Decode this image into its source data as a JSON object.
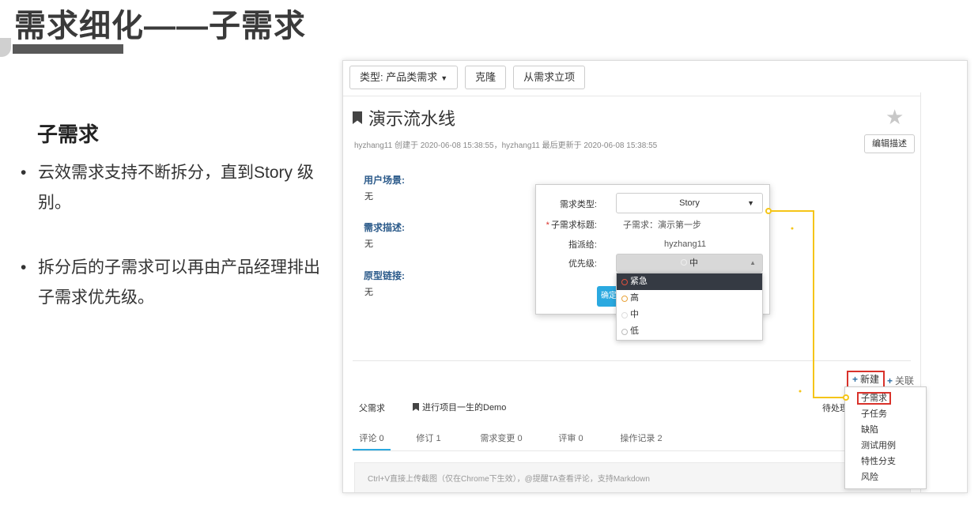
{
  "slide": {
    "title": "需求细化——子需求",
    "heading": "子需求",
    "bullets": [
      "云效需求支持不断拆分，直到Story 级别。",
      "拆分后的子需求可以再由产品经理排出子需求优先级。"
    ],
    "bullet_symbol": "•"
  },
  "toolbar": {
    "type_label": "类型: 产品类需求",
    "clone_label": "克隆",
    "from_req_label": "从需求立项"
  },
  "story": {
    "title": "演示流水线",
    "meta": "hyzhang11 创建于 2020-06-08 15:38:55，hyzhang11 最后更新于 2020-06-08 15:38:55",
    "edit_label": "编辑描述"
  },
  "fields": [
    {
      "label": "用户场景:",
      "value": "无"
    },
    {
      "label": "需求描述:",
      "value": "无"
    },
    {
      "label": "原型链接:",
      "value": "无"
    }
  ],
  "modal": {
    "type_label": "需求类型:",
    "type_value": "Story",
    "title_label": "子需求标题:",
    "title_required": "*",
    "title_value": "子需求：演示第一步",
    "assignee_label": "指派给:",
    "assignee_value": "hyzhang11",
    "priority_label": "优先级:",
    "priority_value": "中",
    "confirm_label": "确定"
  },
  "priority_options": [
    {
      "label": "紧急",
      "color": "#e0503d",
      "active": true
    },
    {
      "label": "高",
      "color": "#e8a33a",
      "active": false
    },
    {
      "label": "中",
      "color": "#dddddd",
      "active": false
    },
    {
      "label": "低",
      "color": "#bbbbbb",
      "active": false
    }
  ],
  "actions": {
    "new_label": "新建",
    "assoc_label": "关联"
  },
  "new_menu": [
    "子需求",
    "子任务",
    "缺陷",
    "测试用例",
    "特性分支",
    "风险"
  ],
  "parent": {
    "label": "父需求",
    "item": "进行项目一生的Demo",
    "status": "待处理"
  },
  "tabs": [
    "评论 0",
    "修订 1",
    "需求变更 0",
    "评审 0",
    "操作记录 2"
  ],
  "comment_placeholder": "Ctrl+V直接上传截图（仅在Chrome下生效），@提醒TA查看评论，支持Markdown",
  "colors": {
    "accent": "#2aa9e0",
    "highlight_red": "#d9322b",
    "connector_yellow": "#f5c518",
    "label_blue": "#2b5a8a"
  }
}
